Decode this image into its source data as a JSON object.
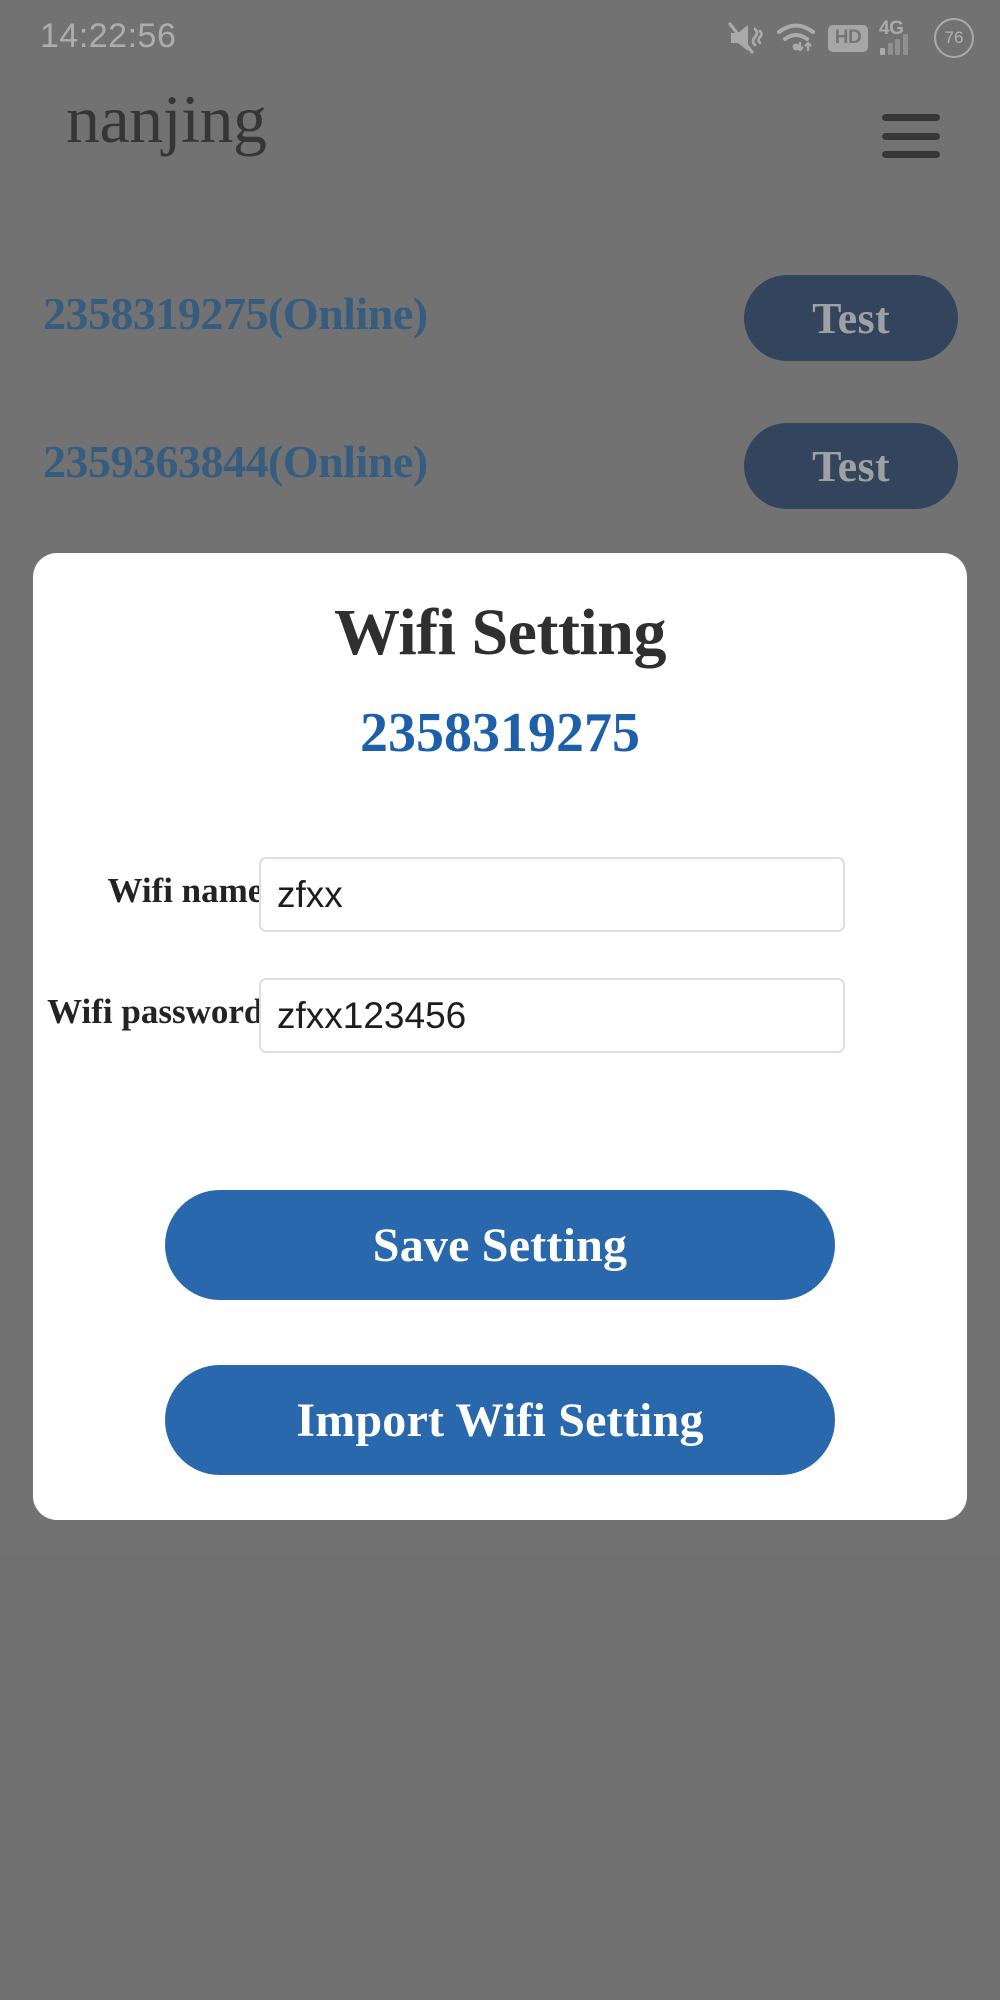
{
  "status_bar": {
    "time": "14:22:56",
    "icons": [
      {
        "name": "mute-vibrate-icon",
        "label": ""
      },
      {
        "name": "wifi-icon",
        "label": ""
      },
      {
        "name": "hd-icon",
        "label": "HD"
      },
      {
        "name": "signal-4g-icon",
        "label": "4G"
      },
      {
        "name": "battery-icon",
        "label": "76"
      }
    ],
    "battery_level": "76",
    "network_type": "4G",
    "hd_label": "HD"
  },
  "header": {
    "title": "nanjing",
    "menu_icon": "hamburger-menu-icon"
  },
  "device_list": [
    {
      "name": "2358319275(Online)",
      "action_label": "Test"
    },
    {
      "name": "2359363844(Online)",
      "action_label": "Test"
    }
  ],
  "modal": {
    "title": "Wifi Setting",
    "device_id": "2358319275",
    "fields": [
      {
        "label": "Wifi name:",
        "value": "zfxx",
        "placeholder": "Wifi name"
      },
      {
        "label": "Wifi password:",
        "value": "zfxx123456",
        "placeholder": "Wifi password"
      }
    ],
    "save_label": "Save Setting",
    "import_label": "Import Wifi Setting"
  },
  "colors": {
    "accent_blue": "#2a68ad",
    "dark_navy": "#17355f",
    "link_blue": "#1d6099",
    "title_blue": "#1d5fa8",
    "background_gray": "#808080"
  }
}
